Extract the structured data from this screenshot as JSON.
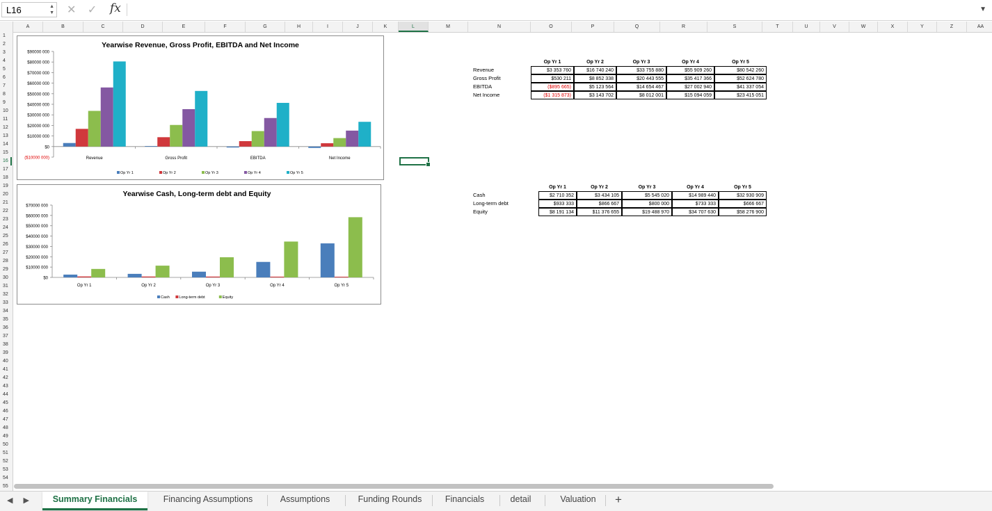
{
  "name_box": "L16",
  "formula_icons": {
    "cancel": "✕",
    "enter": "✓",
    "fx": "fx"
  },
  "columns": [
    {
      "label": "A",
      "w": 43
    },
    {
      "label": "B",
      "w": 58
    },
    {
      "label": "C",
      "w": 57
    },
    {
      "label": "D",
      "w": 57
    },
    {
      "label": "E",
      "w": 61
    },
    {
      "label": "F",
      "w": 58
    },
    {
      "label": "G",
      "w": 57
    },
    {
      "label": "H",
      "w": 40
    },
    {
      "label": "I",
      "w": 43
    },
    {
      "label": "J",
      "w": 43
    },
    {
      "label": "K",
      "w": 37
    },
    {
      "label": "L",
      "w": 43
    },
    {
      "label": "M",
      "w": 57
    },
    {
      "label": "N",
      "w": 90
    },
    {
      "label": "O",
      "w": 59
    },
    {
      "label": "P",
      "w": 61
    },
    {
      "label": "Q",
      "w": 66
    },
    {
      "label": "R",
      "w": 68
    },
    {
      "label": "S",
      "w": 79
    },
    {
      "label": "T",
      "w": 44
    },
    {
      "label": "U",
      "w": 39
    },
    {
      "label": "V",
      "w": 42
    },
    {
      "label": "W",
      "w": 41
    },
    {
      "label": "X",
      "w": 43
    },
    {
      "label": "Y",
      "w": 42
    },
    {
      "label": "Z",
      "w": 43
    },
    {
      "label": "AA",
      "w": 40
    }
  ],
  "selected_column": "L",
  "selected_row": 16,
  "row_count": 55,
  "chart1": {
    "title": "Yearwise Revenue, Gross Profit, EBITDA and Net Income",
    "chart_data": {
      "type": "bar",
      "categories": [
        "Revenue",
        "Gross Profit",
        "EBITDA",
        "Net Income"
      ],
      "series": [
        {
          "name": "Op Yr 1",
          "color": "#4a7ebb",
          "values": [
            3353760,
            530211,
            -895665,
            -1315873
          ]
        },
        {
          "name": "Op Yr 2",
          "color": "#d0383c",
          "values": [
            16740240,
            8852338,
            5123564,
            3143702
          ]
        },
        {
          "name": "Op Yr 3",
          "color": "#8cbd4d",
          "values": [
            33755880,
            20443555,
            14654467,
            8012001
          ]
        },
        {
          "name": "Op Yr 4",
          "color": "#8458a2",
          "values": [
            55909260,
            35417366,
            27002940,
            15094059
          ]
        },
        {
          "name": "Op Yr 5",
          "color": "#1fb0c8",
          "values": [
            80542260,
            52624780,
            41337054,
            23415051
          ]
        }
      ],
      "ylim": [
        -10000000,
        90000000
      ],
      "ticks": [
        "($10000 000)",
        "$0",
        "$10000 000",
        "$20000 000",
        "$30000 000",
        "$40000 000",
        "$50000 000",
        "$60000 000",
        "$70000 000",
        "$80000 000",
        "$90000 000"
      ],
      "legend": "bottom"
    }
  },
  "chart2": {
    "title": "Yearwise Cash, Long-term debt and Equity",
    "chart_data": {
      "type": "bar",
      "categories": [
        "Op Yr 1",
        "Op Yr 2",
        "Op Yr 3",
        "Op Yr 4",
        "Op Yr 5"
      ],
      "series": [
        {
          "name": "Cash",
          "color": "#4a7ebb",
          "values": [
            2710352,
            3434105,
            5545020,
            14989440,
            32930909
          ]
        },
        {
          "name": "Long-term debt",
          "color": "#d0383c",
          "values": [
            933333,
            866667,
            800000,
            733333,
            666667
          ]
        },
        {
          "name": "Equity",
          "color": "#8cbd4d",
          "values": [
            8191134,
            11376655,
            19488970,
            34707630,
            58276900
          ]
        }
      ],
      "ylim": [
        0,
        70000000
      ],
      "ticks": [
        "$0",
        "$10000 000",
        "$20000 000",
        "$30000 000",
        "$40000 000",
        "$50000 000",
        "$60000 000",
        "$70000 000"
      ],
      "legend": "bottom"
    }
  },
  "table1": {
    "headers": [
      "Op Yr 1",
      "Op Yr 2",
      "Op Yr 3",
      "Op Yr 4",
      "Op Yr 5"
    ],
    "rows": [
      {
        "label": "Revenue",
        "cells": [
          "$3 353 760",
          "$16 740 240",
          "$33 755 880",
          "$55 909 260",
          "$80 542 260"
        ],
        "neg": [
          false,
          false,
          false,
          false,
          false
        ]
      },
      {
        "label": "Gross Profit",
        "cells": [
          "$530 211",
          "$8 852 338",
          "$20 443 555",
          "$35 417 366",
          "$52 624 780"
        ],
        "neg": [
          false,
          false,
          false,
          false,
          false
        ]
      },
      {
        "label": "EBITDA",
        "cells": [
          "($895 665)",
          "$5 123 564",
          "$14 654 467",
          "$27 002 940",
          "$41 337 054"
        ],
        "neg": [
          true,
          false,
          false,
          false,
          false
        ]
      },
      {
        "label": "Net Income",
        "cells": [
          "($1 315 873)",
          "$3 143 702",
          "$8 012 001",
          "$15 094 059",
          "$23 415 051"
        ],
        "neg": [
          true,
          false,
          false,
          false,
          false
        ]
      }
    ]
  },
  "table2": {
    "headers": [
      "Op Yr 1",
      "Op Yr 2",
      "Op Yr 3",
      "Op Yr 4",
      "Op Yr 5"
    ],
    "rows": [
      {
        "label": "Cash",
        "cells": [
          "$2 710 352",
          "$3 434 105",
          "$5 545 020",
          "$14 989 440",
          "$32 930 909"
        ]
      },
      {
        "label": "Long-term debt",
        "cells": [
          "$933 333",
          "$866 667",
          "$800 000",
          "$733 333",
          "$666 667"
        ]
      },
      {
        "label": "Equity",
        "cells": [
          "$8 191 134",
          "$11 376 655",
          "$19 488 970",
          "$34 707 630",
          "$58 276 900"
        ]
      }
    ]
  },
  "sheet_tabs": [
    {
      "label": "Summary Financials",
      "active": true
    },
    {
      "label": "Financing Assumptions",
      "active": false
    },
    {
      "label": "Assumptions",
      "active": false
    },
    {
      "label": "Funding Rounds",
      "active": false
    },
    {
      "label": "Financials",
      "active": false
    },
    {
      "label": "detail",
      "active": false
    },
    {
      "label": "Valuation",
      "active": false
    }
  ],
  "add_sheet": "+"
}
